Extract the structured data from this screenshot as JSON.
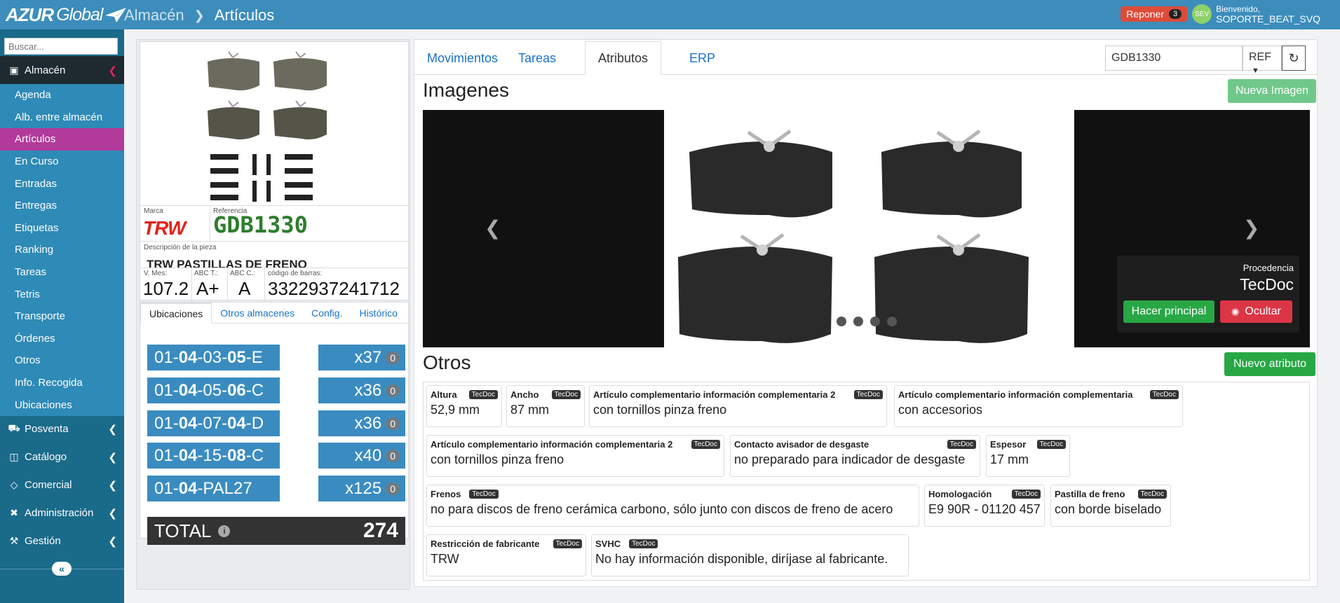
{
  "header": {
    "logo_main": "AZUR",
    "logo_sub": "Global",
    "breadcrumb": [
      "Almacén",
      "Artículos"
    ],
    "reponer_label": "Reponer",
    "reponer_count": "3",
    "avatar_initials": "SEV",
    "welcome_text": "Bienvenido,",
    "username": "SOPORTE_BEAT_SVQ"
  },
  "sidebar": {
    "search_placeholder": "Buscar...",
    "sections": [
      {
        "label": "Almacén",
        "icon": "warehouse-icon",
        "expanded": true
      },
      {
        "label": "Posventa",
        "icon": "truck-icon"
      },
      {
        "label": "Catálogo",
        "icon": "catalog-icon"
      },
      {
        "label": "Comercial",
        "icon": "diamond-icon"
      },
      {
        "label": "Administración",
        "icon": "tools-icon"
      },
      {
        "label": "Gestión",
        "icon": "hammer-icon"
      }
    ],
    "almacen_items": [
      "Agenda",
      "Alb. entre almacén",
      "Artículos",
      "En Curso",
      "Entradas",
      "Entregas",
      "Etiquetas",
      "Ranking",
      "Tareas",
      "Tetris",
      "Transporte",
      "Órdenes",
      "Otros",
      "Info. Recogida",
      "Ubicaciones"
    ],
    "active_item": "Artículos",
    "collapse_glyph": "«"
  },
  "product": {
    "brand_label": "Marca",
    "brand": "TRW",
    "reference_label": "Referencia",
    "reference": "GDB1330",
    "description_label": "Descripción de la pieza",
    "description": "TRW PASTILLAS DE FRENO",
    "vmes_label": "V. Mes:",
    "vmes": "107.2",
    "abct_label": "ABC T.:",
    "abct": "A+",
    "abcc_label": "ABC C.:",
    "abcc": "A",
    "barcode_label": "código de barras:",
    "barcode": "3322937241712"
  },
  "locations": {
    "tabs": [
      "Ubicaciones",
      "Otros almacenes",
      "Config.",
      "Histórico"
    ],
    "active_tab": "Ubicaciones",
    "rows": [
      {
        "prefix": "01-",
        "a": "04",
        "m": "-03-",
        "b": "05",
        "s": "-E",
        "qty": "x37",
        "reserved": "0"
      },
      {
        "prefix": "01-",
        "a": "04",
        "m": "-05-",
        "b": "06",
        "s": "-C",
        "qty": "x36",
        "reserved": "0"
      },
      {
        "prefix": "01-",
        "a": "04",
        "m": "-07-",
        "b": "04",
        "s": "-D",
        "qty": "x36",
        "reserved": "0"
      },
      {
        "prefix": "01-",
        "a": "04",
        "m": "-15-",
        "b": "08",
        "s": "-C",
        "qty": "x40",
        "reserved": "0"
      },
      {
        "prefix": "01-",
        "a": "04",
        "m": "-PAL27",
        "b": "",
        "s": "",
        "qty": "x125",
        "reserved": "0"
      }
    ],
    "total_label": "TOTAL",
    "total_value": "274"
  },
  "main": {
    "tabs": [
      "Movimientos",
      "Tareas",
      "Atributos",
      "ERP"
    ],
    "active_tab": "Atributos",
    "ref_input_value": "GDB1330",
    "ref_select_value": "REF",
    "images_title": "Imagenes",
    "new_image_label": "Nueva Imagen",
    "procedencia_label": "Procedencia",
    "procedencia_value": "TecDoc",
    "make_main_label": "Hacer principal",
    "hide_label": "Ocultar",
    "others_title": "Otros",
    "new_attr_label": "Nuevo atributo",
    "tag_label": "TecDoc",
    "attributes": [
      {
        "name": "Altura",
        "value": "52,9 mm"
      },
      {
        "name": "Ancho",
        "value": "87 mm"
      },
      {
        "name": "Artículo complementario información complementaria 2",
        "value": "con tornillos pinza freno"
      },
      {
        "name": "Artículo complementario información complementaria",
        "value": "con accesorios"
      },
      {
        "name": "Artículo complementario información complementaria 2",
        "value": "con tornillos pinza freno"
      },
      {
        "name": "Contacto avisador de desgaste",
        "value": "no preparado para indicador de desgaste"
      },
      {
        "name": "Espesor",
        "value": "17 mm"
      },
      {
        "name": "Frenos",
        "value": "no para discos de freno cerámica carbono, sólo junto con discos de freno de acero"
      },
      {
        "name": "Homologación",
        "value": "E9 90R - 01120 457"
      },
      {
        "name": "Pastilla de freno",
        "value": "con borde biselado"
      },
      {
        "name": "Restricción de fabricante",
        "value": "TRW"
      },
      {
        "name": "SVHC",
        "value": "No hay información disponible, diríjase al fabricante."
      }
    ]
  },
  "colors": {
    "topbar": "#3c8dbc",
    "sidebar": "#1a6a8a",
    "active_item": "#b23a9a",
    "location_blue": "#3a8cc0",
    "green": "#28a745",
    "red": "#dc3545"
  }
}
